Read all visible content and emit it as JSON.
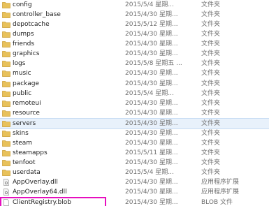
{
  "rows": [
    {
      "name": "config",
      "date": "2015/5/4 星期...",
      "type": "文件夹",
      "icon": "folder-icon"
    },
    {
      "name": "controller_base",
      "date": "2015/4/30 星期...",
      "type": "文件夹",
      "icon": "folder-icon"
    },
    {
      "name": "depotcache",
      "date": "2015/5/12 星期...",
      "type": "文件夹",
      "icon": "folder-icon"
    },
    {
      "name": "dumps",
      "date": "2015/4/30 星期...",
      "type": "文件夹",
      "icon": "folder-icon"
    },
    {
      "name": "friends",
      "date": "2015/4/30 星期...",
      "type": "文件夹",
      "icon": "folder-icon"
    },
    {
      "name": "graphics",
      "date": "2015/4/30 星期...",
      "type": "文件夹",
      "icon": "folder-icon"
    },
    {
      "name": "logs",
      "date": "2015/5/8 星期五 ...",
      "type": "文件夹",
      "icon": "folder-icon"
    },
    {
      "name": "music",
      "date": "2015/4/30 星期...",
      "type": "文件夹",
      "icon": "folder-icon"
    },
    {
      "name": "package",
      "date": "2015/4/30 星期...",
      "type": "文件夹",
      "icon": "folder-icon"
    },
    {
      "name": "public",
      "date": "2015/5/4 星期...",
      "type": "文件夹",
      "icon": "folder-icon"
    },
    {
      "name": "remoteui",
      "date": "2015/4/30 星期...",
      "type": "文件夹",
      "icon": "folder-icon"
    },
    {
      "name": "resource",
      "date": "2015/4/30 星期...",
      "type": "文件夹",
      "icon": "folder-icon"
    },
    {
      "name": "servers",
      "date": "2015/4/30 星期...",
      "type": "文件夹",
      "icon": "folder-icon"
    },
    {
      "name": "skins",
      "date": "2015/4/30 星期...",
      "type": "文件夹",
      "icon": "folder-icon"
    },
    {
      "name": "steam",
      "date": "2015/4/30 星期...",
      "type": "文件夹",
      "icon": "folder-icon"
    },
    {
      "name": "steamapps",
      "date": "2015/5/11 星期...",
      "type": "文件夹",
      "icon": "folder-icon"
    },
    {
      "name": "tenfoot",
      "date": "2015/4/30 星期...",
      "type": "文件夹",
      "icon": "folder-icon"
    },
    {
      "name": "userdata",
      "date": "2015/5/4 星期...",
      "type": "文件夹",
      "icon": "folder-icon"
    },
    {
      "name": "AppOverlay.dll",
      "date": "2015/4/30 星期...",
      "type": "应用程序扩展",
      "icon": "dll-file-icon"
    },
    {
      "name": "AppOverlay64.dll",
      "date": "2015/4/30 星期...",
      "type": "应用程序扩展",
      "icon": "dll-file-icon"
    },
    {
      "name": "ClientRegistry.blob",
      "date": "2015/4/30 星期...",
      "type": "BLOB 文件",
      "icon": "blob-file-icon"
    }
  ],
  "selected_row": "servers",
  "colors": {
    "folder": "#e8c15a",
    "highlight_border": "#e60fbe",
    "selected_bg": "#e8f1fb"
  }
}
